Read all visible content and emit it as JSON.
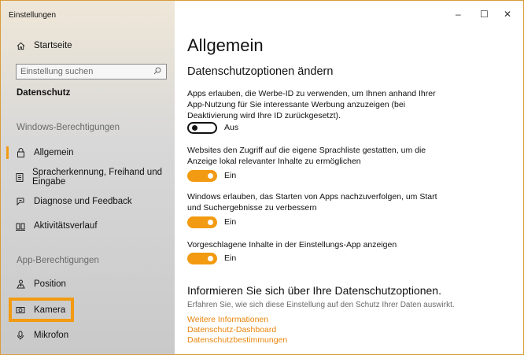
{
  "window": {
    "title": "Einstellungen",
    "controls": {
      "minimize": "–",
      "maximize": "☐",
      "close": "✕"
    }
  },
  "sidebar": {
    "home": {
      "label": "Startseite",
      "icon": "home-icon"
    },
    "search": {
      "placeholder": "Einstellung suchen",
      "icon": "search-icon"
    },
    "category": "Datenschutz",
    "group1": "Windows-Berechtigungen",
    "items1": [
      {
        "label": "Allgemein",
        "icon": "lock-icon",
        "selected": true
      },
      {
        "label": "Spracherkennung, Freihand und Eingabe",
        "icon": "notepad-icon"
      },
      {
        "label": "Diagnose und Feedback",
        "icon": "feedback-icon"
      },
      {
        "label": "Aktivitätsverlauf",
        "icon": "timeline-icon"
      }
    ],
    "group2": "App-Berechtigungen",
    "items2": [
      {
        "label": "Position",
        "icon": "location-icon"
      },
      {
        "label": "Kamera",
        "icon": "camera-icon",
        "highlighted": true
      },
      {
        "label": "Mikrofon",
        "icon": "microphone-icon"
      }
    ]
  },
  "main": {
    "title": "Allgemein",
    "subtitle": "Datenschutzoptionen ändern",
    "settings": [
      {
        "text": "Apps erlauben, die Werbe-ID zu verwenden, um Ihnen anhand Ihrer App-Nutzung für Sie interessante Werbung anzuzeigen (bei Deaktivierung wird Ihre ID zurückgesetzt).",
        "state": "Aus",
        "on": false
      },
      {
        "text": "Websites den Zugriff auf die eigene Sprachliste gestatten, um die Anzeige lokal relevanter Inhalte zu ermöglichen",
        "state": "Ein",
        "on": true
      },
      {
        "text": "Windows erlauben, das Starten von Apps nachzuverfolgen, um Start und Suchergebnisse zu verbessern",
        "state": "Ein",
        "on": true
      },
      {
        "text": "Vorgeschlagene Inhalte in der Einstellungs-App anzeigen",
        "state": "Ein",
        "on": true
      }
    ],
    "info_title": "Informieren Sie sich über Ihre Datenschutzoptionen.",
    "info_text": "Erfahren Sie, wie sich diese Einstellung auf den Schutz Ihrer Daten auswirkt.",
    "links": [
      "Weitere Informationen",
      "Datenschutz-Dashboard",
      "Datenschutzbestimmungen"
    ]
  },
  "colors": {
    "accent": "#f29a11",
    "link": "#e8850c"
  }
}
